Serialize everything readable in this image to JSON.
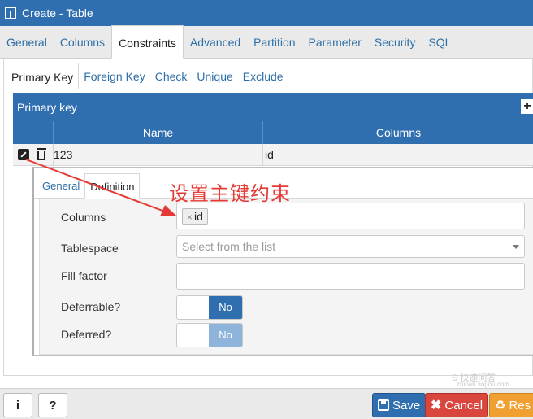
{
  "window": {
    "title": "Create - Table"
  },
  "main_tabs": [
    {
      "label": "General"
    },
    {
      "label": "Columns"
    },
    {
      "label": "Constraints",
      "active": true
    },
    {
      "label": "Advanced"
    },
    {
      "label": "Partition"
    },
    {
      "label": "Parameter"
    },
    {
      "label": "Security"
    },
    {
      "label": "SQL"
    }
  ],
  "sub_tabs": [
    {
      "label": "Primary Key",
      "active": true
    },
    {
      "label": "Foreign Key"
    },
    {
      "label": "Check"
    },
    {
      "label": "Unique"
    },
    {
      "label": "Exclude"
    }
  ],
  "primary_key": {
    "header": "Primary key",
    "add_label": "+",
    "columns_header": [
      "Name",
      "Columns"
    ],
    "rows": [
      {
        "name": "123",
        "columns": "id"
      }
    ]
  },
  "detail": {
    "tabs": [
      {
        "label": "General"
      },
      {
        "label": "Definition",
        "active": true
      }
    ],
    "fields": {
      "columns_label": "Columns",
      "columns_chip_x": "×",
      "columns_chip": "id",
      "tablespace_label": "Tablespace",
      "tablespace_placeholder": "Select from the list",
      "fill_factor_label": "Fill factor",
      "fill_factor_value": "",
      "deferrable_label": "Deferrable?",
      "deferrable_value": "No",
      "deferred_label": "Deferred?",
      "deferred_value": "No"
    }
  },
  "annotation": {
    "text": "设置主键约束",
    "color": "#e53935"
  },
  "footer": {
    "info_label": "i",
    "help_label": "?",
    "save_label": "Save",
    "cancel_label": "Cancel",
    "reset_label": "Res"
  },
  "watermark": {
    "line1": "S 快速问答",
    "line2": "zhinan.sogou.com"
  },
  "colors": {
    "accent": "#2f6fb0",
    "danger": "#d9463e",
    "warning": "#f0a030",
    "toggle_on": "#2f6fb0",
    "toggle_disabled": "#8fb4dc"
  }
}
